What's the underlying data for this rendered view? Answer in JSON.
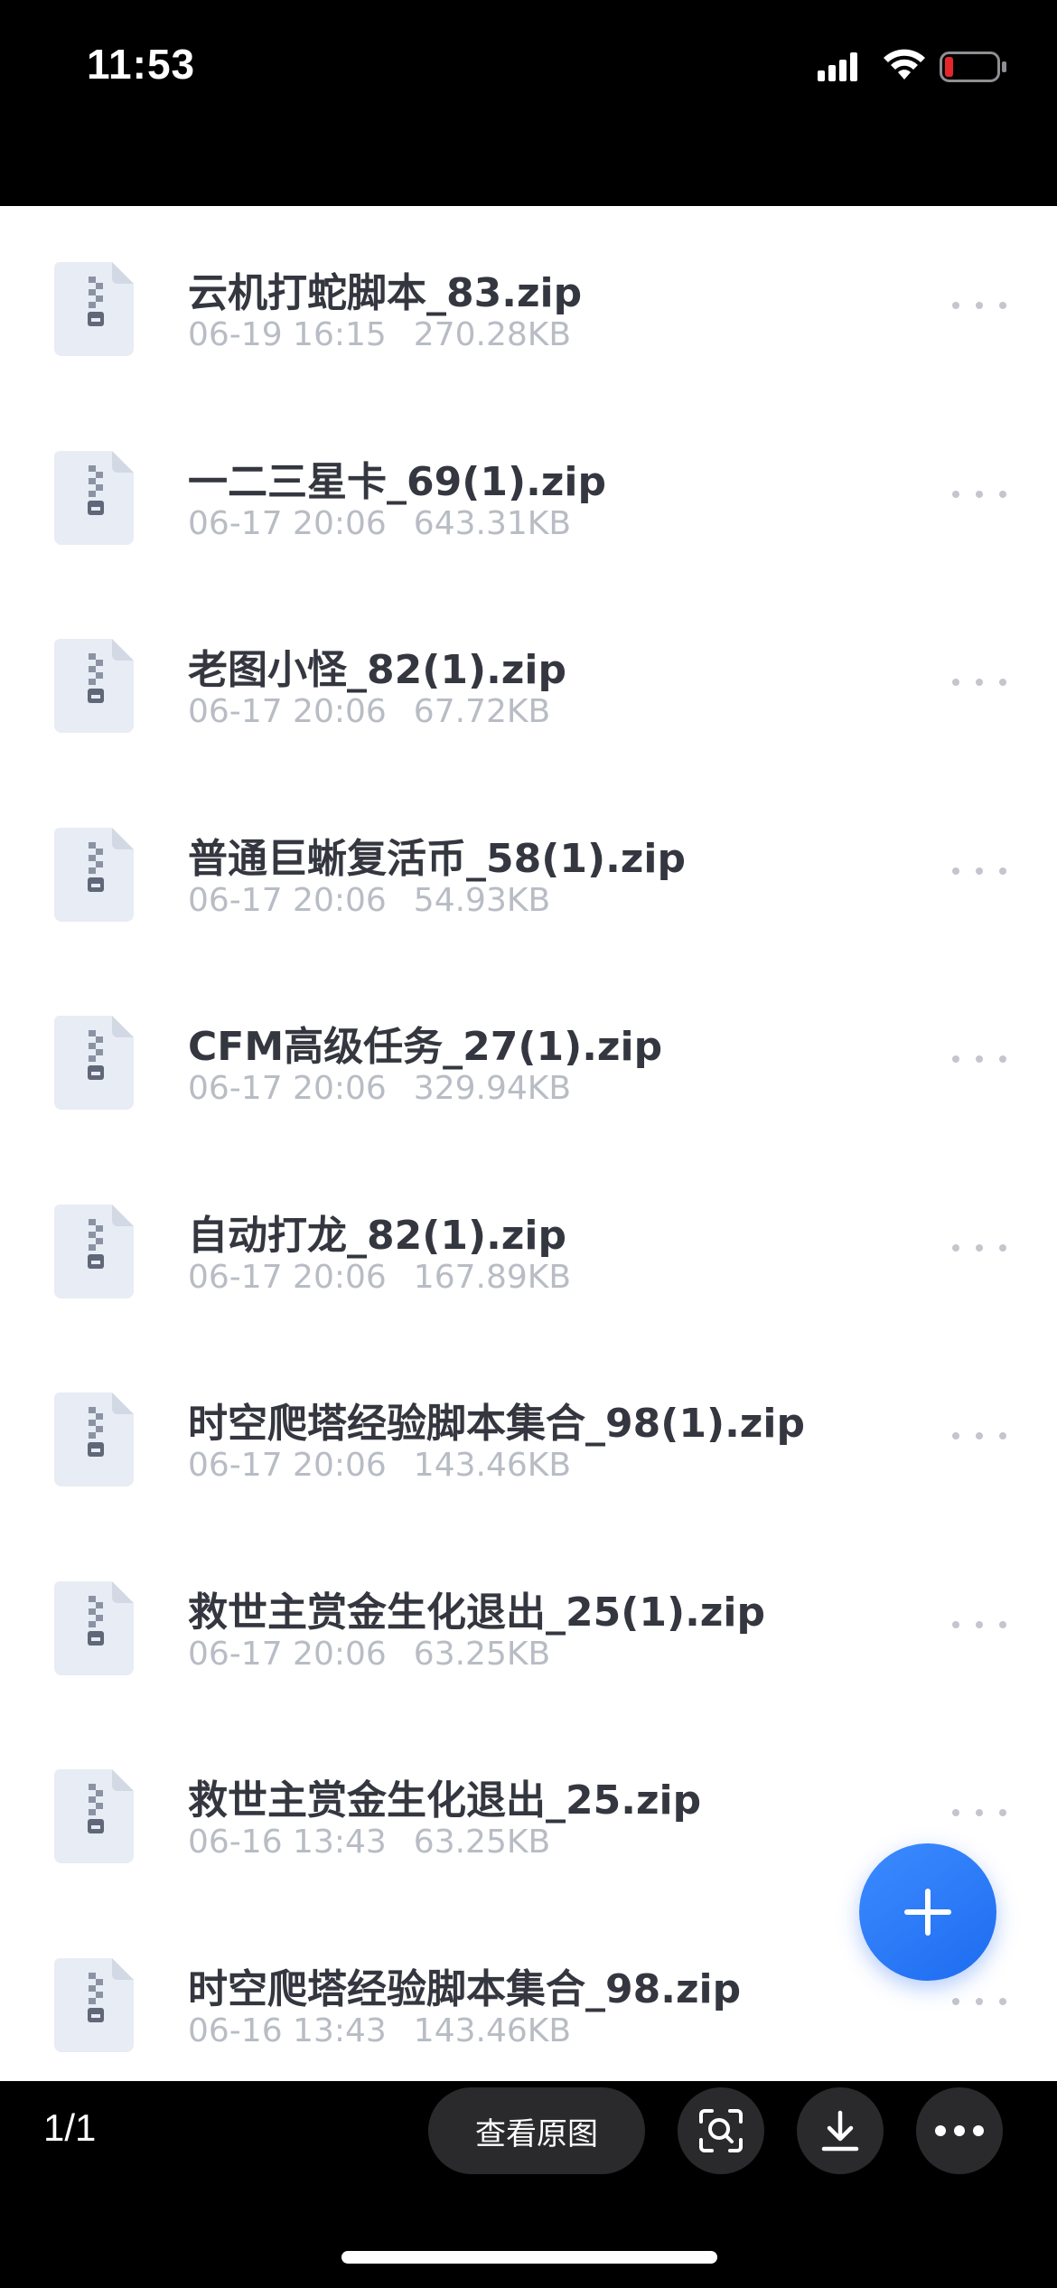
{
  "status_bar": {
    "time": "11:53"
  },
  "files": [
    {
      "name": "云机打蛇脚本_83.zip",
      "date": "06-19 16:15",
      "size": "270.28KB"
    },
    {
      "name": "一二三星卡_69(1).zip",
      "date": "06-17 20:06",
      "size": "643.31KB"
    },
    {
      "name": "老图小怪_82(1).zip",
      "date": "06-17 20:06",
      "size": "67.72KB"
    },
    {
      "name": "普通巨蜥复活币_58(1).zip",
      "date": "06-17 20:06",
      "size": "54.93KB"
    },
    {
      "name": "CFM高级任务_27(1).zip",
      "date": "06-17 20:06",
      "size": "329.94KB"
    },
    {
      "name": "自动打龙_82(1).zip",
      "date": "06-17 20:06",
      "size": "167.89KB"
    },
    {
      "name": "时空爬塔经验脚本集合_98(1).zip",
      "date": "06-17 20:06",
      "size": "143.46KB"
    },
    {
      "name": "救世主赏金生化退出_25(1).zip",
      "date": "06-17 20:06",
      "size": "63.25KB"
    },
    {
      "name": "救世主赏金生化退出_25.zip",
      "date": "06-16 13:43",
      "size": "63.25KB"
    },
    {
      "name": "时空爬塔经验脚本集合_98.zip",
      "date": "06-16 13:43",
      "size": "143.46KB"
    }
  ],
  "fab": {
    "icon": "plus-icon",
    "color": "#2f7bf7"
  },
  "viewer_bar": {
    "page_counter": "1/1",
    "view_original_label": "查看原图",
    "icons": [
      "scan-search-icon",
      "download-icon",
      "more-icon"
    ]
  },
  "colors": {
    "file_name": "#34373f",
    "file_meta": "#b8bcc4",
    "fab": "#2f7bf7",
    "battery_low": "#e5262b"
  }
}
